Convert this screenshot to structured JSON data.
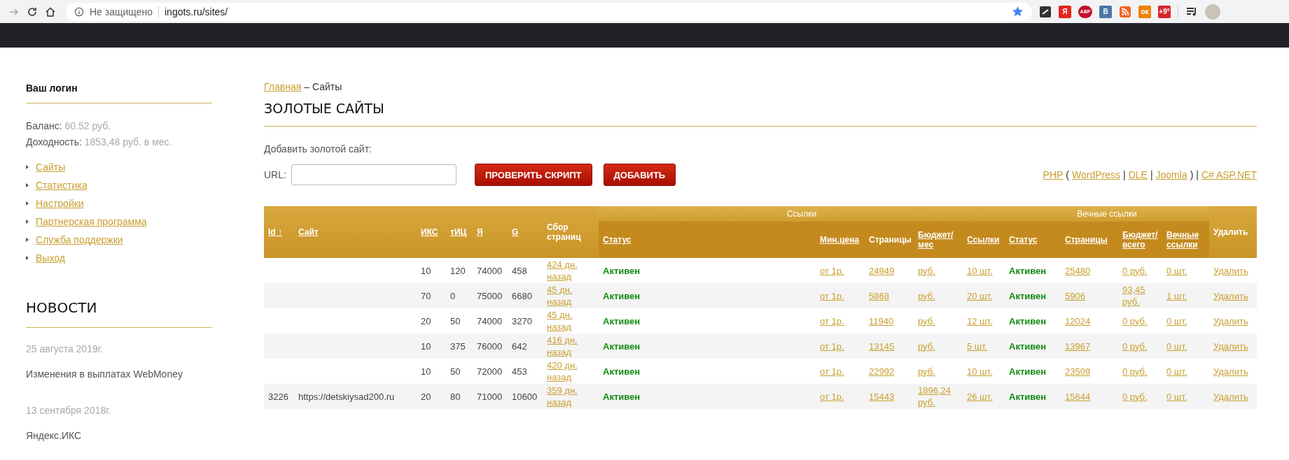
{
  "browser": {
    "security": "Не защищено",
    "url": "ingots.ru/sites/",
    "back_disabled": true,
    "extensions": [
      {
        "kind": "square",
        "color": "#333333"
      },
      {
        "kind": "letter",
        "label": "Я",
        "color": "#e52620"
      },
      {
        "kind": "round",
        "label": "ABP",
        "color": "#c70d2c"
      },
      {
        "kind": "letter",
        "label": "В",
        "color": "#4a76a8"
      },
      {
        "kind": "rss",
        "color": "#f26522"
      },
      {
        "kind": "letter",
        "label": "ок",
        "color": "#ee8208"
      },
      {
        "kind": "letter",
        "label": "+9°",
        "color": "#d8262b"
      }
    ]
  },
  "sidebar": {
    "login_label": "Ваш логин",
    "balance_label": "Баланс:",
    "balance": "60.52 руб.",
    "income_label": "Доходность:",
    "income": "1853,48 руб. в мес.",
    "menu": [
      "Сайты",
      "Статистика",
      "Настройки",
      "Партнерская программа",
      "Служба поддержки",
      "Выход"
    ],
    "news_title": "НОВОСТИ",
    "news": [
      {
        "date": "25 августа 2019г.",
        "title": "Изменения в выплатах WebMoney"
      },
      {
        "date": "13 сентября 2018г.",
        "title": "Яндекс.ИКС"
      }
    ]
  },
  "breadcrumb": {
    "home": "Главная",
    "separator": "–",
    "current": "Сайты"
  },
  "title": "ЗОЛОТЫЕ САЙТЫ",
  "add_form": {
    "label": "Добавить золотой сайт:",
    "url_label": "URL:",
    "check_button": "ПРОВЕРИТЬ СКРИПТ",
    "add_button": "ДОБАВИТЬ",
    "links": [
      {
        "kind": "link",
        "text": "PHP"
      },
      {
        "kind": "text",
        "text": "("
      },
      {
        "kind": "link",
        "text": "WordPress"
      },
      {
        "kind": "text",
        "text": "|"
      },
      {
        "kind": "link",
        "text": "DLE"
      },
      {
        "kind": "text",
        "text": "|"
      },
      {
        "kind": "link",
        "text": "Joomla"
      },
      {
        "kind": "text",
        "text": ") |"
      },
      {
        "kind": "link",
        "text": "C# ASP.NET"
      }
    ]
  },
  "table": {
    "groups": [
      "Ссылки",
      "Вечные ссылки"
    ],
    "columns": [
      {
        "label": "Id ↑",
        "sortable": true
      },
      {
        "label": "Сайт",
        "sortable": true
      },
      {
        "label": "ИКС",
        "sortable": true
      },
      {
        "label": "тИЦ",
        "sortable": true
      },
      {
        "label": "Я",
        "sortable": true
      },
      {
        "label": "G",
        "sortable": true
      },
      {
        "label": "Сбор страниц",
        "sortable": false
      },
      {
        "label": "Статус",
        "sortable": true
      },
      {
        "label": "Мин.цена",
        "sortable": true
      },
      {
        "label": "Страницы",
        "sortable": false
      },
      {
        "label": "Бюджет/ мес",
        "sortable": true
      },
      {
        "label": "Ссылки",
        "sortable": true
      },
      {
        "label": "Статус",
        "sortable": true
      },
      {
        "label": "Страницы",
        "sortable": true
      },
      {
        "label": "Бюджет/ всего",
        "sortable": true
      },
      {
        "label": "Вечные ссылки",
        "sortable": true
      },
      {
        "label": "Удалить",
        "sortable": false
      }
    ],
    "rows": [
      {
        "iks": "10",
        "tic": "120",
        "ya": "74000",
        "g": "458",
        "collected": "424 дн. назад",
        "status": "Активен",
        "min_price": "от 1р.",
        "pages": "24949",
        "budget": "руб.",
        "links": "10 шт.",
        "e_status": "Активен",
        "e_pages": "25480",
        "e_budget": "0 руб.",
        "e_links": "0 шт.",
        "delete": "Удалить"
      },
      {
        "iks": "70",
        "tic": "0",
        "ya": "75000",
        "g": "6680",
        "collected": "45 дн. назад",
        "status": "Активен",
        "min_price": "от 1р.",
        "pages": "5868",
        "budget": "руб.",
        "links": "20 шт.",
        "e_status": "Активен",
        "e_pages": "5906",
        "e_budget": "93,45 руб.",
        "e_links": "1 шт.",
        "delete": "Удалить"
      },
      {
        "iks": "20",
        "tic": "50",
        "ya": "74000",
        "g": "3270",
        "collected": "45 дн. назад",
        "status": "Активен",
        "min_price": "от 1р.",
        "pages": "11940",
        "budget": "руб.",
        "links": "12 шт.",
        "e_status": "Активен",
        "e_pages": "12024",
        "e_budget": "0 руб.",
        "e_links": "0 шт.",
        "delete": "Удалить"
      },
      {
        "iks": "10",
        "tic": "375",
        "ya": "76000",
        "g": "642",
        "collected": "416 дн. назад",
        "status": "Активен",
        "min_price": "от 1р.",
        "pages": "13145",
        "budget": "руб.",
        "links": "5 шт.",
        "e_status": "Активен",
        "e_pages": "13967",
        "e_budget": "0 руб.",
        "e_links": "0 шт.",
        "delete": "Удалить"
      },
      {
        "iks": "10",
        "tic": "50",
        "ya": "72000",
        "g": "453",
        "collected": "420 дн. назад",
        "status": "Активен",
        "min_price": "от 1р.",
        "pages": "22992",
        "budget": "руб.",
        "links": "10 шт.",
        "e_status": "Активен",
        "e_pages": "23509",
        "e_budget": "0 руб.",
        "e_links": "0 шт.",
        "delete": "Удалить"
      },
      {
        "id": "3226",
        "site": "https://detskiysad200.ru",
        "iks": "20",
        "tic": "80",
        "ya": "71000",
        "g": "10600",
        "collected": "359 дн. назад",
        "status": "Активен",
        "min_price": "от 1р.",
        "pages": "15443",
        "budget": "1896,24 руб.",
        "links": "26 шт.",
        "e_status": "Активен",
        "e_pages": "15644",
        "e_budget": "0 руб.",
        "e_links": "0 шт.",
        "delete": "Удалить"
      }
    ]
  }
}
